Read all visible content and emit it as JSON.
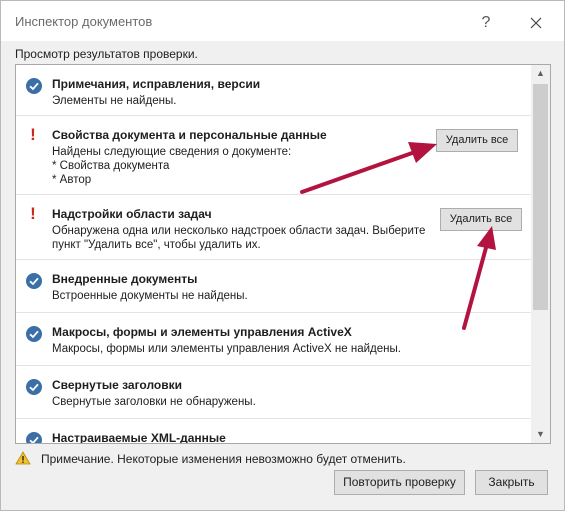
{
  "window": {
    "title": "Инспектор документов",
    "help_glyph": "?"
  },
  "subtitle": "Просмотр результатов проверки.",
  "results": [
    {
      "status": "ok",
      "title": "Примечания, исправления, версии",
      "description": "Элементы не найдены."
    },
    {
      "status": "warning",
      "title": "Свойства документа и персональные данные",
      "description": "Найдены следующие сведения о документе:\n* Свойства документа\n* Автор",
      "button": "Удалить все"
    },
    {
      "status": "warning",
      "title": "Надстройки области задач",
      "description": "Обнаружена одна или несколько надстроек области задач. Выберите пункт \"Удалить все\", чтобы удалить их.",
      "button": "Удалить все"
    },
    {
      "status": "ok",
      "title": "Внедренные документы",
      "description": "Встроенные документы не найдены."
    },
    {
      "status": "ok",
      "title": "Макросы, формы и элементы управления ActiveX",
      "description": "Макросы, формы или элементы управления ActiveX не найдены."
    },
    {
      "status": "ok",
      "title": "Свернутые заголовки",
      "description": "Свернутые заголовки не обнаружены."
    },
    {
      "status": "ok",
      "title": "Настраиваемые XML-данные",
      "description": ""
    }
  ],
  "footer": {
    "note": "Примечание. Некоторые изменения невозможно будет отменить.",
    "recheck_button": "Повторить проверку",
    "close_button": "Закрыть"
  },
  "colors": {
    "ok_icon": "#3a6fa8",
    "warning": "#c42b1c",
    "annotation_arrow": "#b3133f"
  }
}
